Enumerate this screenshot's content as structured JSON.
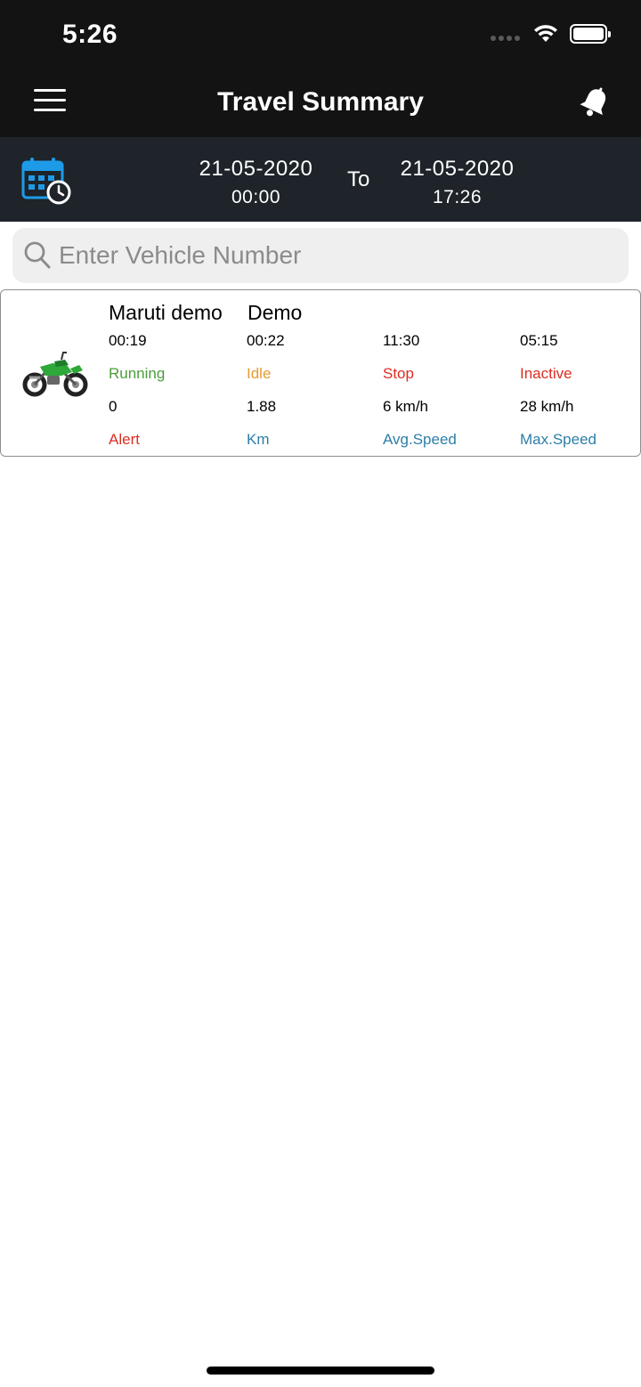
{
  "status_bar": {
    "time": "5:26"
  },
  "nav": {
    "title": "Travel Summary"
  },
  "date_range": {
    "from_date": "21-05-2020",
    "from_time": "00:00",
    "separator": "To",
    "to_date": "21-05-2020",
    "to_time": "17:26"
  },
  "search": {
    "placeholder": "Enter Vehicle Number",
    "value": ""
  },
  "vehicles": [
    {
      "name": "Maruti demo",
      "group": "Demo",
      "running_time": "00:19",
      "running_label": "Running",
      "idle_time": "00:22",
      "idle_label": "Idle",
      "stop_time": "11:30",
      "stop_label": "Stop",
      "inactive_time": "05:15",
      "inactive_label": "Inactive",
      "alert_count": "0",
      "alert_label": "Alert",
      "distance": "1.88",
      "distance_label": "Km",
      "avg_speed": "6 km/h",
      "avg_speed_label": "Avg.Speed",
      "max_speed": "28 km/h",
      "max_speed_label": "Max.Speed",
      "icon": "motorcycle-icon"
    }
  ],
  "colors": {
    "header_bg": "#131313",
    "date_bar_bg": "#1e2429",
    "running": "#4a9d3c",
    "idle": "#e89a2e",
    "stop": "#dc2d21",
    "label_blue": "#2c7ea9",
    "calendar_accent": "#1e9be8"
  }
}
